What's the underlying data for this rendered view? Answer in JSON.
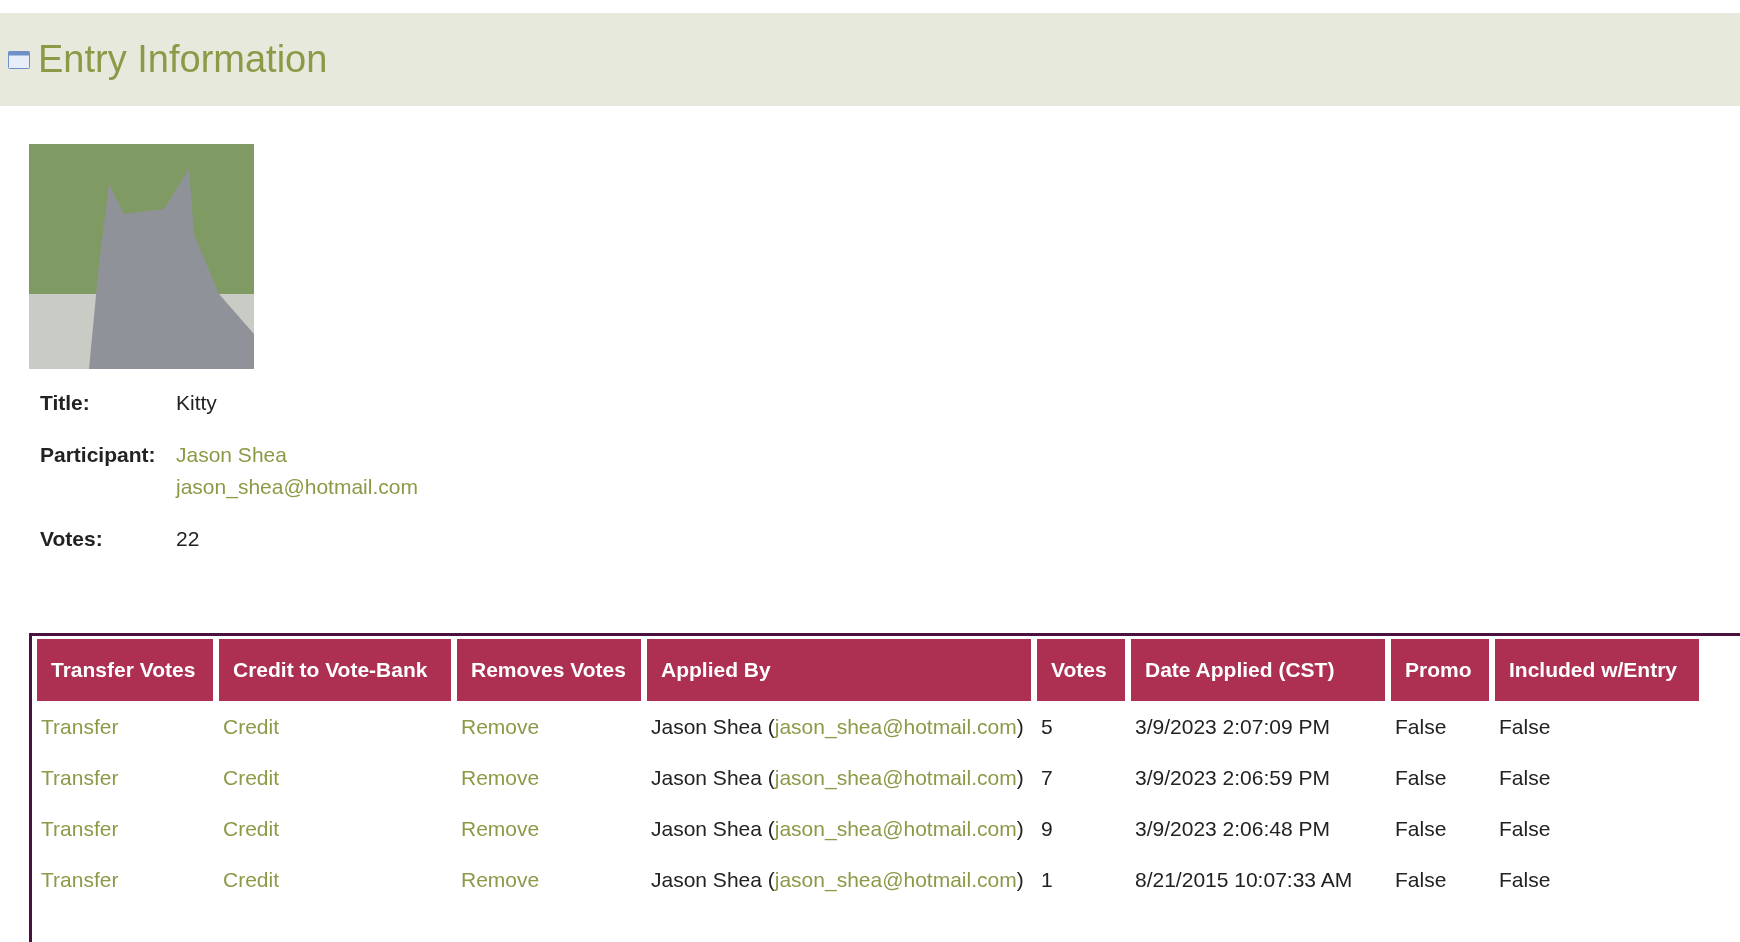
{
  "header": {
    "title": "Entry Information"
  },
  "entry": {
    "fields": [
      {
        "label": "Title:",
        "kind": "text",
        "value": "Kitty"
      },
      {
        "label": "Participant:",
        "kind": "contact",
        "name": "Jason Shea",
        "email": "jason_shea@hotmail.com"
      },
      {
        "label": "Votes:",
        "kind": "text",
        "value": "22"
      }
    ]
  },
  "table": {
    "columns": [
      "Transfer Votes",
      "Credit to Vote-Bank",
      "Removes Votes",
      "Applied By",
      "Votes",
      "Date Applied (CST)",
      "Promo",
      "Included w/Entry"
    ],
    "rows": [
      {
        "transfer": "Transfer",
        "credit": "Credit",
        "remove": "Remove",
        "applied_by_name": "Jason Shea (",
        "applied_by_email": "jason_shea@hotmail.com",
        "applied_by_close": ")",
        "votes": "5",
        "date": "3/9/2023 2:07:09 PM",
        "promo": "False",
        "included": "False"
      },
      {
        "transfer": "Transfer",
        "credit": "Credit",
        "remove": "Remove",
        "applied_by_name": "Jason Shea (",
        "applied_by_email": "jason_shea@hotmail.com",
        "applied_by_close": ")",
        "votes": "7",
        "date": "3/9/2023 2:06:59 PM",
        "promo": "False",
        "included": "False"
      },
      {
        "transfer": "Transfer",
        "credit": "Credit",
        "remove": "Remove",
        "applied_by_name": "Jason Shea (",
        "applied_by_email": "jason_shea@hotmail.com",
        "applied_by_close": ")",
        "votes": "9",
        "date": "3/9/2023 2:06:48 PM",
        "promo": "False",
        "included": "False"
      },
      {
        "transfer": "Transfer",
        "credit": "Credit",
        "remove": "Remove",
        "applied_by_name": "Jason Shea (",
        "applied_by_email": "jason_shea@hotmail.com",
        "applied_by_close": ")",
        "votes": "1",
        "date": "8/21/2015 10:07:33 AM",
        "promo": "False",
        "included": "False"
      }
    ]
  }
}
